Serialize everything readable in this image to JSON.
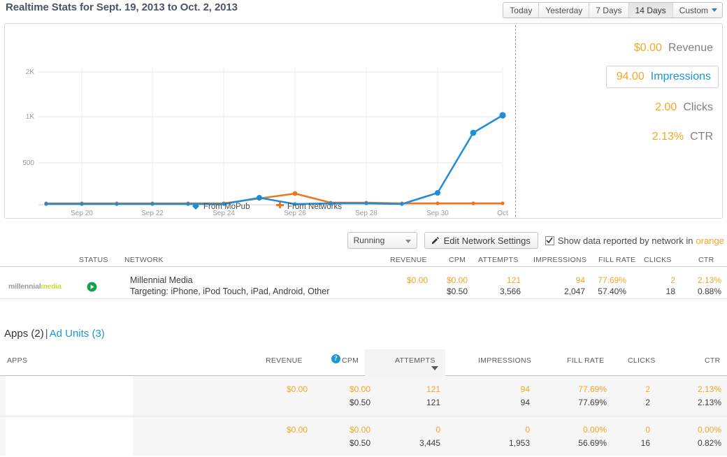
{
  "header": {
    "title": "Realtime Stats for Sept. 19, 2013 to Oct. 2, 2013",
    "date_buttons": [
      {
        "label": "Today",
        "selected": false
      },
      {
        "label": "Yesterday",
        "selected": false
      },
      {
        "label": "7 Days",
        "selected": false
      },
      {
        "label": "14 Days",
        "selected": true
      },
      {
        "label": "Custom",
        "selected": false,
        "has_caret": true
      }
    ]
  },
  "stats": [
    {
      "value": "$0.00",
      "label": "Revenue",
      "active": false
    },
    {
      "value": "94.00",
      "label": "Impressions",
      "active": true
    },
    {
      "value": "2.00",
      "label": "Clicks",
      "active": false
    },
    {
      "value": "2.13%",
      "label": "CTR",
      "active": false
    }
  ],
  "controls": {
    "status_select": "Running",
    "edit_button": "Edit Network Settings",
    "checkbox_checked": true,
    "checkbox_text": "Show data reported by network in",
    "checkbox_highlight": "orange"
  },
  "network_table": {
    "headers": [
      "STATUS",
      "NETWORK",
      "REVENUE",
      "CPM",
      "ATTEMPTS",
      "IMPRESSIONS",
      "FILL RATE",
      "CLICKS",
      "CTR"
    ],
    "row": {
      "logo_gray": "millennial",
      "logo_yellow": "media",
      "status": "running",
      "name": "Millennial Media",
      "targeting": "Targeting: iPhone, iPod Touch, iPad, Android, Other",
      "revenue_mopub": "$0.00",
      "revenue_network": "",
      "cpm_mopub": "$0.00",
      "cpm_network": "$0.50",
      "attempts_mopub": "121",
      "attempts_network": "3,566",
      "impressions_mopub": "94",
      "impressions_network": "2,047",
      "fillrate_mopub": "77.69%",
      "fillrate_network": "57.40%",
      "clicks_mopub": "2",
      "clicks_network": "18",
      "ctr_mopub": "2.13%",
      "ctr_network": "0.88%"
    }
  },
  "apps_section": {
    "apps_label": "Apps (2)",
    "separator": "|",
    "adunits_label": "Ad Units (3)",
    "headers": [
      "APPS",
      "REVENUE",
      "CPM",
      "ATTEMPTS",
      "IMPRESSIONS",
      "FILL RATE",
      "CLICKS",
      "CTR"
    ],
    "sorted_column": "ATTEMPTS",
    "sort_direction": "desc",
    "rows": [
      {
        "name": "",
        "revenue_mopub": "$0.00",
        "revenue_network": "",
        "cpm_mopub": "$0.00",
        "cpm_network": "$0.50",
        "attempts_mopub": "121",
        "attempts_network": "121",
        "impressions_mopub": "94",
        "impressions_network": "94",
        "fillrate_mopub": "77.69%",
        "fillrate_network": "77.69%",
        "clicks_mopub": "2",
        "clicks_network": "2",
        "ctr_mopub": "2.13%",
        "ctr_network": "2.13%"
      },
      {
        "name": "",
        "revenue_mopub": "$0.00",
        "revenue_network": "",
        "cpm_mopub": "$0.00",
        "cpm_network": "$0.50",
        "attempts_mopub": "0",
        "attempts_network": "3,445",
        "impressions_mopub": "0",
        "impressions_network": "1,953",
        "fillrate_mopub": "0.00%",
        "fillrate_network": "56.69%",
        "clicks_mopub": "0",
        "clicks_network": "16",
        "ctr_mopub": "0.00%",
        "ctr_network": "0.82%"
      }
    ]
  },
  "chart_data": {
    "type": "line",
    "title": "",
    "xlabel": "",
    "ylabel": "",
    "grid": true,
    "legend_position": "bottom",
    "y_ticks": [
      "500",
      "1K",
      "2K"
    ],
    "x_tick_labels": [
      "Sep 20",
      "Sep 22",
      "Sep 24",
      "Sep 26",
      "Sep 28",
      "Sep 30",
      "Oct"
    ],
    "x": [
      "Sep 19",
      "Sep 20",
      "Sep 21",
      "Sep 22",
      "Sep 23",
      "Sep 24",
      "Sep 25",
      "Sep 26",
      "Sep 27",
      "Sep 28",
      "Sep 29",
      "Sep 30",
      "Oct 1",
      "Oct 2"
    ],
    "series": [
      {
        "name": "From MoPub",
        "color": "#1f8dd6",
        "values": [
          0,
          0,
          0,
          0,
          0,
          0,
          94,
          20,
          4,
          6,
          2,
          121,
          730,
          1010
        ]
      },
      {
        "name": "From Networks",
        "color": "#e87722",
        "values": [
          3,
          3,
          3,
          3,
          3,
          3,
          60,
          121,
          6,
          8,
          4,
          5,
          6,
          6
        ]
      }
    ],
    "ylim": [
      0,
      2000
    ]
  }
}
